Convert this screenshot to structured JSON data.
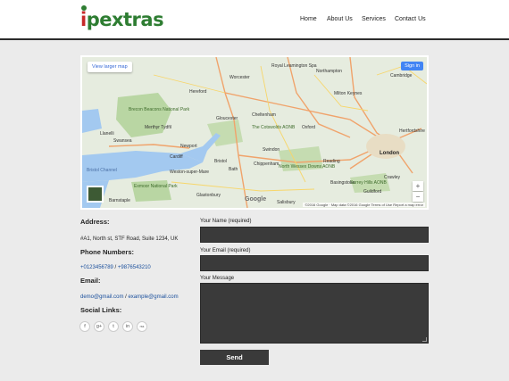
{
  "header": {
    "logo_i": "i",
    "logo_rest": "pextras",
    "nav": [
      "Home",
      "About Us",
      "Services",
      "Contact Us"
    ]
  },
  "map": {
    "view_larger": "View larger map",
    "sign_in": "Sign in",
    "zoom_in": "+",
    "zoom_out": "−",
    "google": "Google",
    "attribution": "©2016 Google · Map data ©2016 Google   Terms of Use   Report a map error",
    "places": [
      "Hereford",
      "Worcester",
      "Royal Leamington Spa",
      "Northampton",
      "Cambridge",
      "Milton Keynes",
      "Cheltenham",
      "Gloucester",
      "Oxford",
      "Swindon",
      "Reading",
      "London",
      "Newport",
      "Cardiff",
      "Bristol",
      "Bath",
      "Swansea",
      "Weston-super-Mare",
      "Chippenham",
      "Basingstoke",
      "Guildford",
      "Crawley",
      "Salisbury",
      "Glastonbury",
      "Barnstaple",
      "Llanelli",
      "Merthyr Tydfil",
      "Bristol Channel",
      "Brecon Beacons National Park",
      "The Cotswolds AONB",
      "North Wessex Downs AONB",
      "Exmoor National Park",
      "Surrey Hills AONB",
      "Hertfordshire"
    ]
  },
  "contact_info": {
    "address_heading": "Address:",
    "address": "#A1, North st, STF Road, Suite 1234, UK",
    "phone_heading": "Phone Numbers:",
    "phone1": "+0123456789",
    "phone_sep": " / ",
    "phone2": "+9876543210",
    "email_heading": "Email:",
    "email1": "demo@gmail.com",
    "email_sep": " / ",
    "email2": "example@gmail.com",
    "social_heading": "Social Links:",
    "social_icons": [
      "facebook-icon",
      "google-plus-icon",
      "twitter-icon",
      "linkedin-icon",
      "rss-icon"
    ],
    "social_glyphs": [
      "f",
      "g+",
      "t",
      "in",
      "rss"
    ]
  },
  "form": {
    "name_label": "Your Name (required)",
    "email_label": "Your Email (required)",
    "message_label": "Your Message",
    "send_label": "Send"
  }
}
